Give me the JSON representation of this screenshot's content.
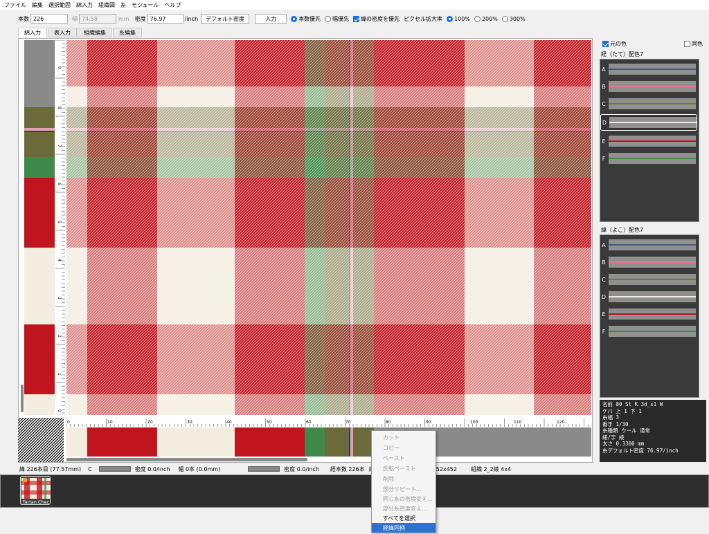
{
  "menu": [
    "ファイル",
    "編集",
    "選択範囲",
    "綿入力",
    "組織図",
    "糸",
    "モジュール",
    "ヘルプ"
  ],
  "toolbar": {
    "count_label": "本数",
    "count_value": "226",
    "width_label": "幅",
    "width_value": "74.58",
    "width_unit": "mm",
    "density_label": "密度",
    "density_value": "76.97",
    "density_unit": "/inch",
    "default_density_btn": "デフォルト密度",
    "input_btn": "入力",
    "count_priority": "本数優先",
    "width_priority": "幅優先",
    "warp_density_priority": "緯の密度を優先",
    "pixel_zoom_label": "ピクセル拡大率",
    "zoom_100": "100%",
    "zoom_200": "200%",
    "zoom_300": "300%"
  },
  "tabs": [
    "綿入力",
    "表入力",
    "組織編集",
    "糸編集"
  ],
  "ruler_v_labels": [
    "9",
    "8",
    "7",
    "6",
    "5",
    "4",
    "3",
    "2",
    "1",
    "0"
  ],
  "ruler_h_labels": [
    "0",
    "10",
    "20",
    "30",
    "40",
    "50",
    "60",
    "70",
    "80",
    "90",
    "100",
    "110",
    "120"
  ],
  "right": {
    "original_color": "元の色",
    "same_color": "同色",
    "warp_title": "経（たて）配色7",
    "weft_title": "緯（よこ）配色7",
    "warp_yarns": [
      {
        "letter": "A",
        "color": "#4a5a7a"
      },
      {
        "letter": "B",
        "color": "#e07a88"
      },
      {
        "letter": "C",
        "color": "#6a7a3a"
      },
      {
        "letter": "D",
        "color": "#f0ece0"
      },
      {
        "letter": "E",
        "color": "#b8142a"
      },
      {
        "letter": "F",
        "color": "#3f8a4a"
      }
    ],
    "weft_yarns": [
      {
        "letter": "A",
        "color": "#4a5a7a"
      },
      {
        "letter": "B",
        "color": "#e07a88"
      },
      {
        "letter": "C",
        "color": "#6a7a3a"
      },
      {
        "letter": "D",
        "color": "#f0ece0"
      },
      {
        "letter": "E",
        "color": "#b8142a"
      },
      {
        "letter": "F",
        "color": "#3f8a4a"
      }
    ],
    "info_lines": [
      "名前  80 St K 3d_s1 W",
      "ケバ  上 1 下 1",
      "糸幅  3",
      "番手  1/30",
      "糸種類  ウール  通常",
      "縒/宇  綾",
      "太さ  0.3300 mm",
      "糸デフォルト密度  76.97/inch"
    ]
  },
  "status": {
    "s1": "緯 226本目 (77.57mm)",
    "s2": "C",
    "s3": "密度 0.0/inch",
    "s4": "幅 0本 (0.0mm)",
    "s5": "密度 0.0/inch",
    "s6": "経本数 226本",
    "s7": "緯",
    "s8": "452x452",
    "s9": "組織 2_2綾 4x4"
  },
  "context_menu": [
    {
      "label": "カット",
      "enabled": false
    },
    {
      "label": "コピー",
      "enabled": false
    },
    {
      "label": "ペースト",
      "enabled": false
    },
    {
      "label": "反転ペースト",
      "enabled": false
    },
    {
      "label": "削除",
      "enabled": false
    },
    {
      "label": "部分リピート...",
      "enabled": false
    },
    {
      "label": "同じ糸の密度変え...",
      "enabled": false
    },
    {
      "label": "部分糸密度変え...",
      "enabled": false
    },
    {
      "label": "すべてを選択",
      "enabled": true
    },
    {
      "label": "経緯同柄",
      "enabled": true
    }
  ],
  "thumbnail": {
    "name": "Tartan Chec"
  },
  "colors": {
    "red": "#c0141e",
    "cream": "#f3ede0",
    "green": "#3f8a4a",
    "olive": "#6b6a3a",
    "grey": "#8a8a8a",
    "pink": "#e8a0b0",
    "navy": "#2e3e6e",
    "accent": "#2d72d2"
  }
}
